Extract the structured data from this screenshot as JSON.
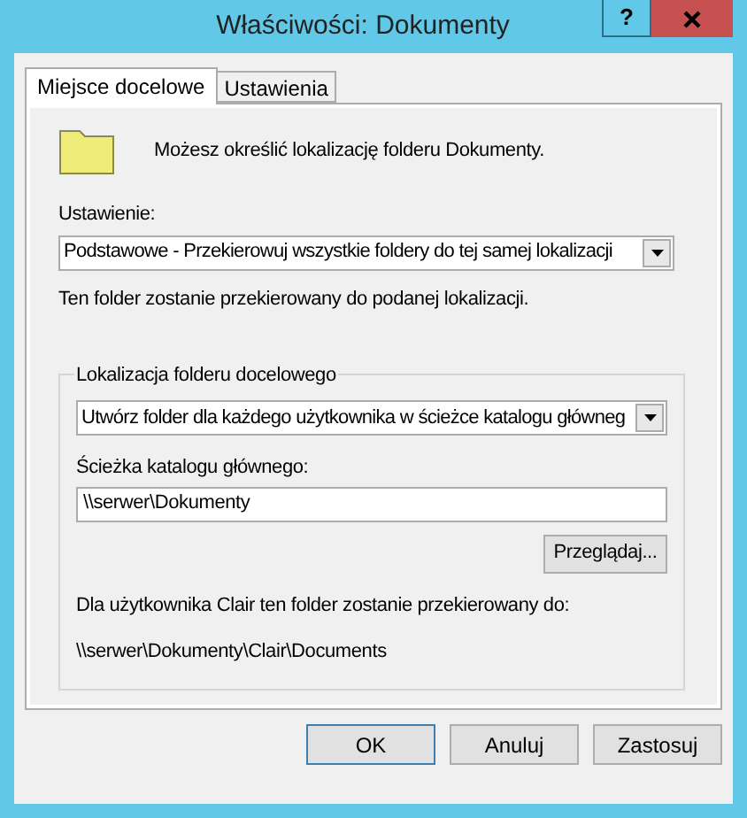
{
  "window": {
    "title": "Właściwości: Dokumenty",
    "help_button": "?"
  },
  "tabs": [
    {
      "label": "Miejsce docelowe",
      "selected": true
    },
    {
      "label": "Ustawienia",
      "selected": false
    }
  ],
  "intro": "Możesz określić lokalizację folderu Dokumenty.",
  "setting": {
    "label": "Ustawienie:",
    "value": "Podstawowe - Przekierowuj wszystkie foldery do tej samej lokalizacji"
  },
  "setting_note": "Ten folder zostanie przekierowany do podanej lokalizacji.",
  "target_group": {
    "title": "Lokalizacja folderu docelowego",
    "option": "Utwórz folder dla każdego użytkownika w ścieżce katalogu główneg",
    "path_label": "Ścieżka katalogu głównego:",
    "path_value": "\\\\serwer\\Dokumenty",
    "browse_button": "Przeglądaj...",
    "example_label": "Dla użytkownika Clair ten folder zostanie przekierowany do:",
    "example_path": "\\\\serwer\\Dokumenty\\Clair\\Documents"
  },
  "buttons": [
    {
      "label": "OK",
      "selected": true
    },
    {
      "label": "Anuluj",
      "selected": false
    },
    {
      "label": "Zastosuj",
      "selected": false
    }
  ]
}
